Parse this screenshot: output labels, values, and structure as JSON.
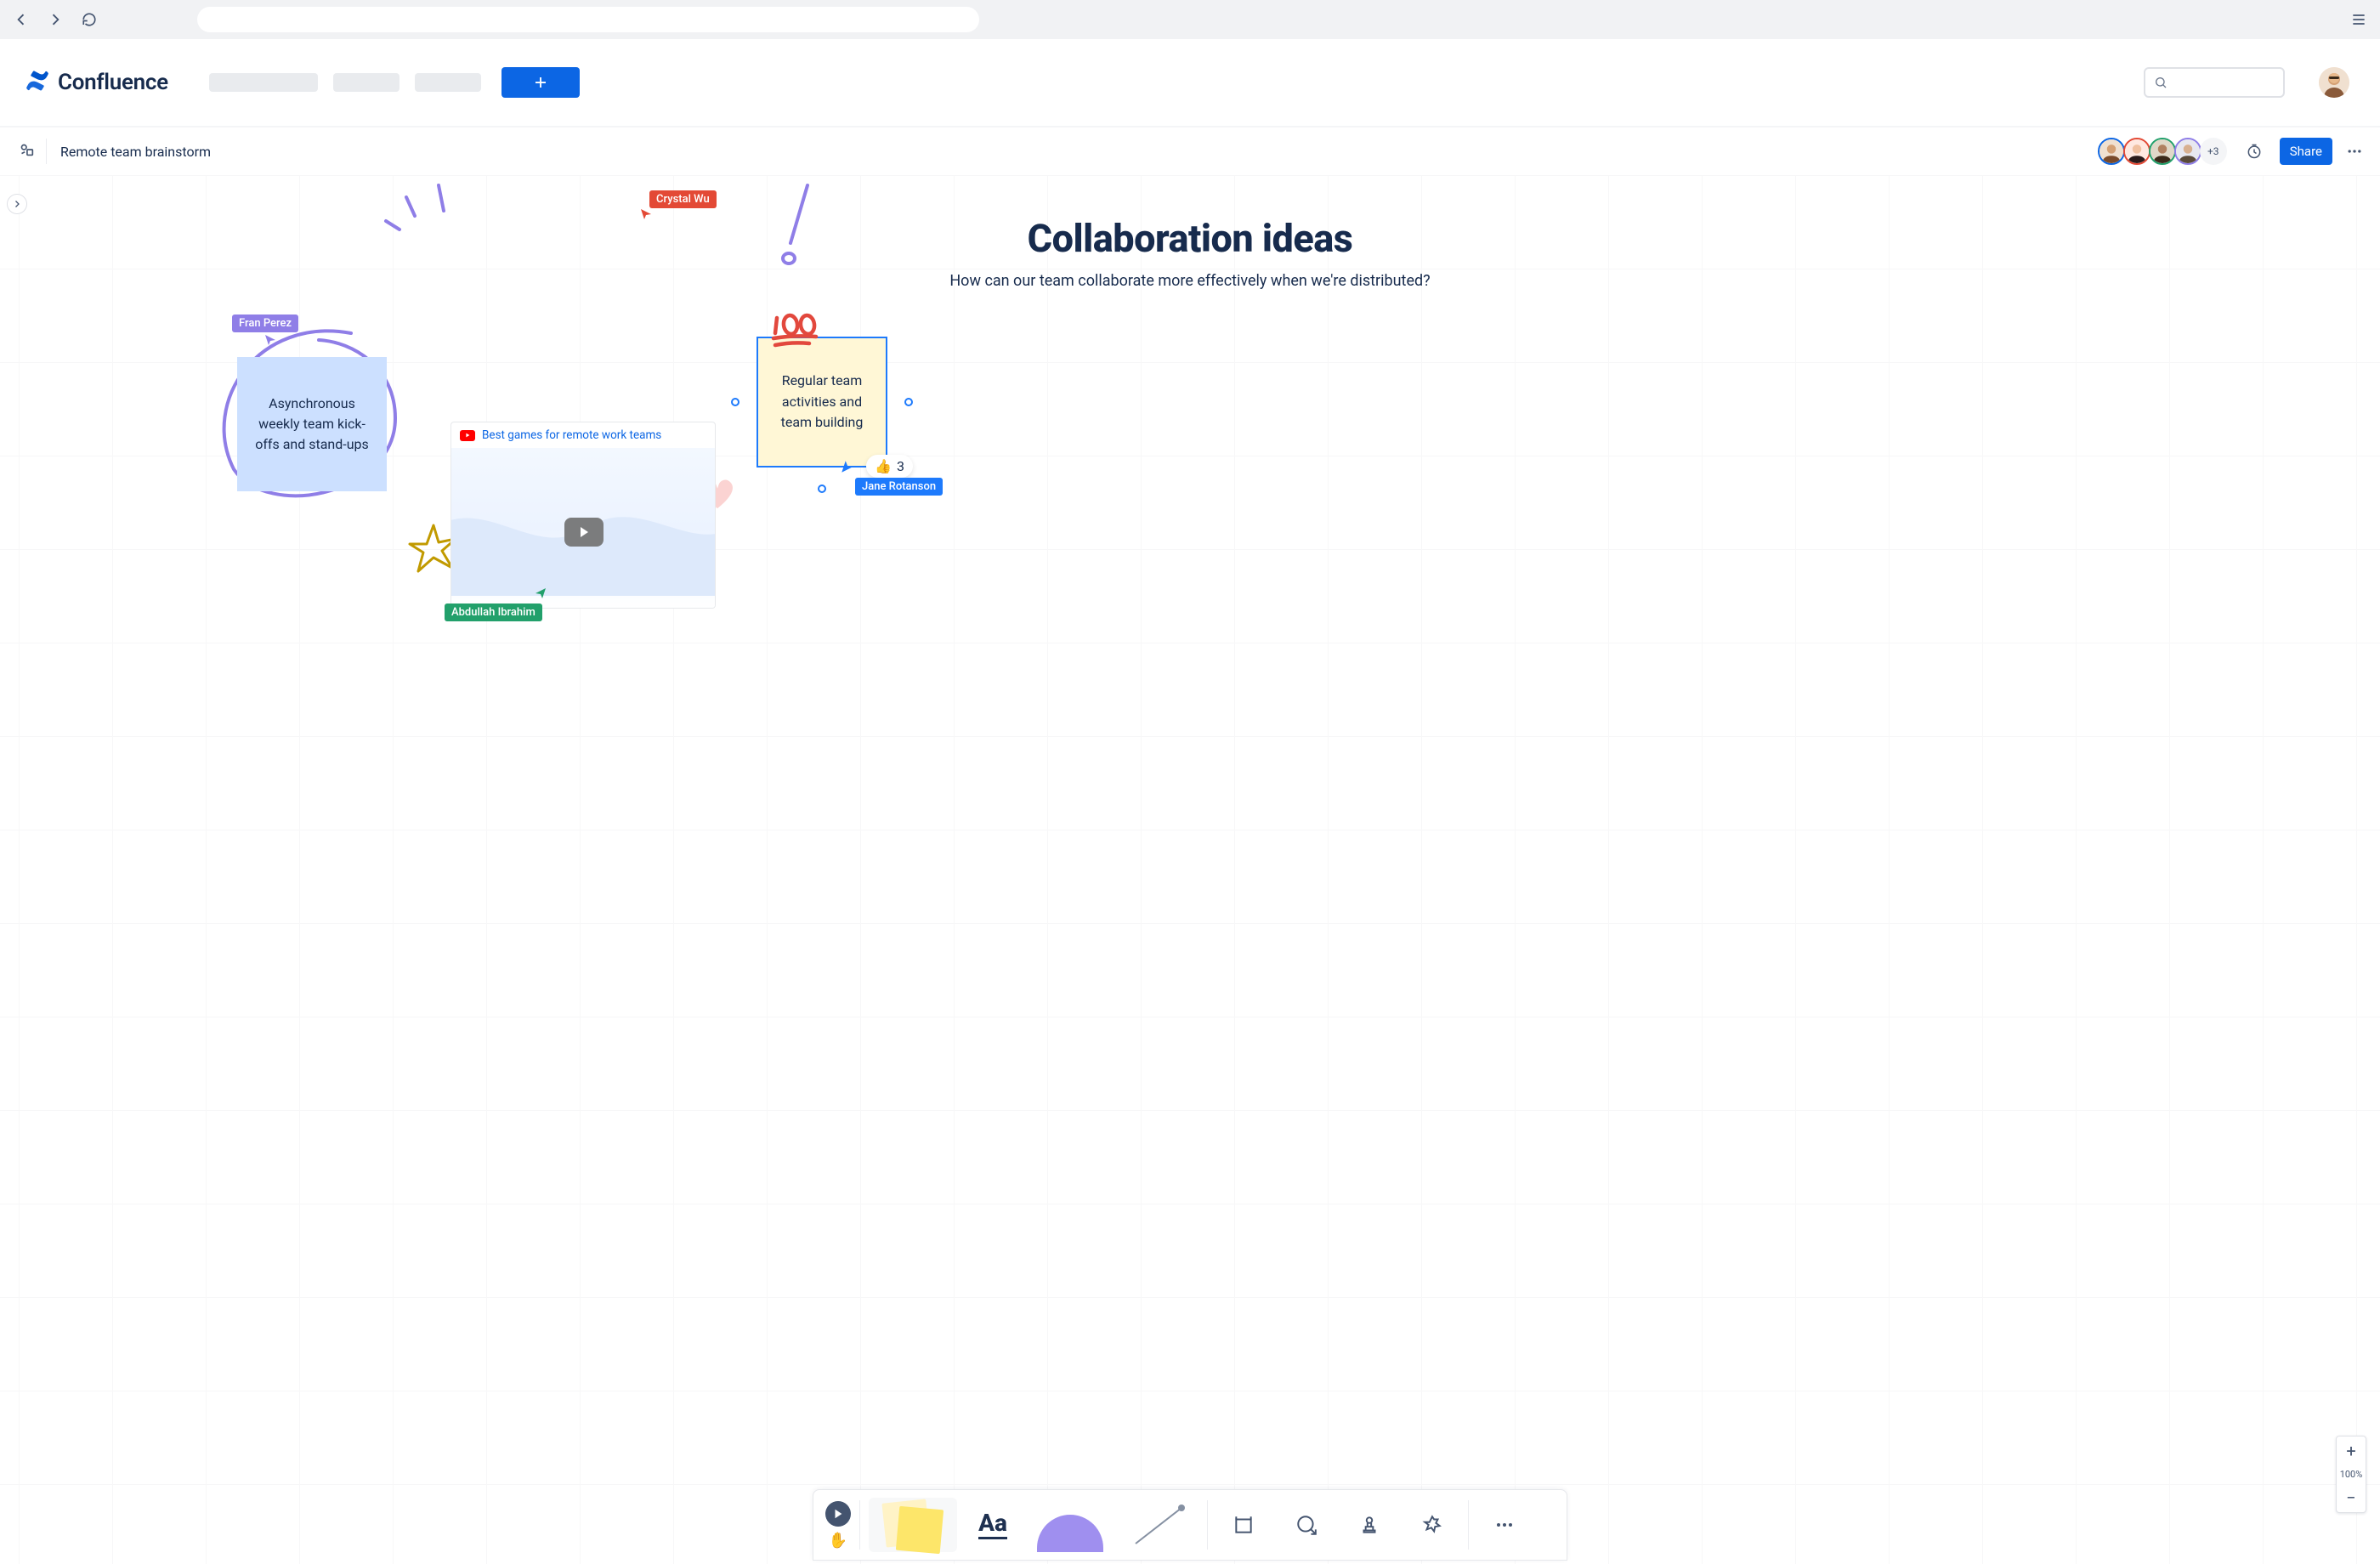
{
  "app": {
    "name": "Confluence"
  },
  "doc": {
    "title": "Remote team brainstorm"
  },
  "share_label": "Share",
  "presence_more": "+3",
  "canvas": {
    "heading": "Collaboration ideas",
    "subtitle": "How can our team collaborate more effectively when we're distributed?"
  },
  "cursors": {
    "crystal": "Crystal Wu",
    "fran": "Fran Perez",
    "abdullah": "Abdullah Ibrahim",
    "jane": "Jane Rotanson"
  },
  "stickies": {
    "blue": "Asynchronous weekly team kick-offs and stand-ups",
    "yellow": "Regular team activities and team building"
  },
  "reactions": {
    "thumbs_count": "3"
  },
  "video": {
    "title": "Best games for remote work teams"
  },
  "zoom": {
    "value": "100%"
  },
  "toolbar": {
    "text_label": "Aa"
  },
  "colors": {
    "blue_primary": "#0c66e4",
    "purple": "#8f7ee7",
    "red": "#e34935",
    "green": "#22a06b"
  }
}
